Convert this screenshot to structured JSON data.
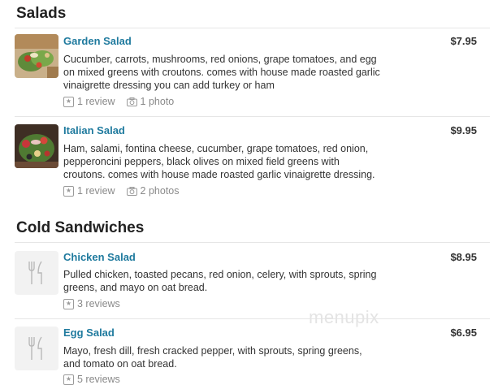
{
  "sections": [
    {
      "title": "Salads",
      "items": [
        {
          "name": "Garden Salad",
          "price": "$7.95",
          "description_lines": [
            "Cucumber, carrots, mushrooms, red onions, grape tomatoes, and egg",
            "on mixed greens with croutons. comes with house made roasted garlic",
            "vinaigrette dressing you can add turkey or ham"
          ],
          "reviews": "1 review",
          "photos": "1 photo"
        },
        {
          "name": "Italian Salad",
          "price": "$9.95",
          "description_lines": [
            "Ham, salami, fontina cheese, cucumber, grape tomatoes, red onion,",
            "pepperoncini peppers, black olives on mixed field greens with",
            "croutons. comes with house made roasted garlic vinaigrette dressing."
          ],
          "reviews": "1 review",
          "photos": "2 photos"
        }
      ]
    },
    {
      "title": "Cold Sandwiches",
      "items": [
        {
          "name": "Chicken Salad",
          "price": "$8.95",
          "description_lines": [
            "Pulled chicken, toasted pecans, red onion, celery, with sprouts, spring",
            "greens, and mayo on oat bread."
          ],
          "reviews": "3 reviews"
        },
        {
          "name": "Egg Salad",
          "price": "$6.95",
          "description_lines": [
            "Mayo, fresh dill, fresh cracked pepper, with sprouts, spring greens,",
            "and tomato on oat bread."
          ],
          "reviews": "5 reviews"
        }
      ]
    }
  ],
  "watermark": "menupix",
  "icons": {
    "review": "star-box-icon",
    "photo": "camera-icon",
    "placeholder": "fork-knife-icon"
  },
  "colors": {
    "item_name": "#1f7a9e",
    "meta": "#8a8a8a"
  }
}
